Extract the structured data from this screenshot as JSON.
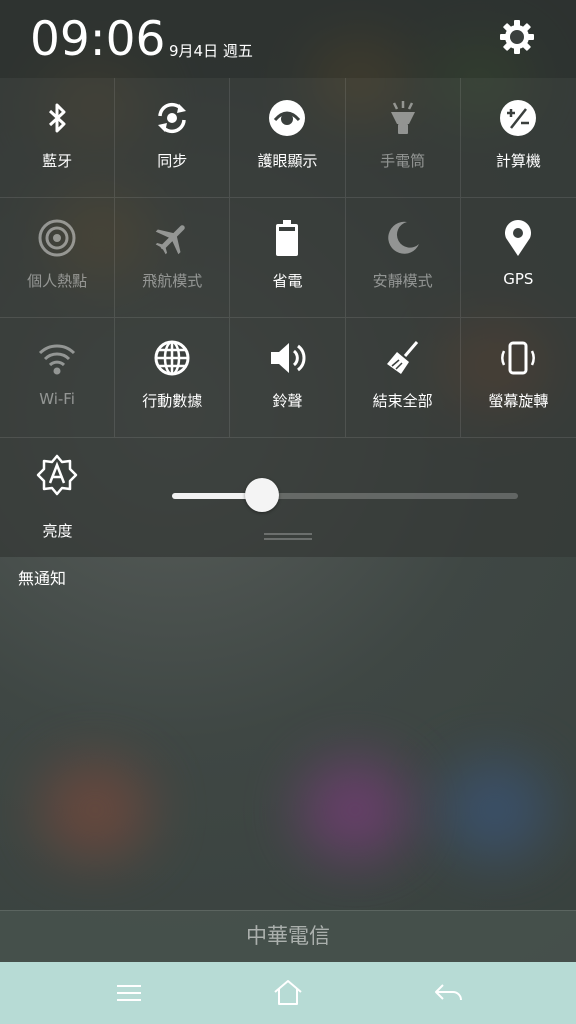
{
  "status": {
    "time": "09:06",
    "date": "9月4日 週五"
  },
  "header": {
    "settings_icon": "gear-icon"
  },
  "tiles": [
    {
      "label": "藍牙",
      "icon": "bluetooth-icon",
      "active": true
    },
    {
      "label": "同步",
      "icon": "sync-icon",
      "active": true
    },
    {
      "label": "護眼顯示",
      "icon": "eye-icon",
      "active": true
    },
    {
      "label": "手電筒",
      "icon": "flashlight-icon",
      "active": false
    },
    {
      "label": "計算機",
      "icon": "calculator-icon",
      "active": true
    },
    {
      "label": "個人熱點",
      "icon": "hotspot-icon",
      "active": false
    },
    {
      "label": "飛航模式",
      "icon": "airplane-icon",
      "active": false
    },
    {
      "label": "省電",
      "icon": "battery-icon",
      "active": true
    },
    {
      "label": "安靜模式",
      "icon": "moon-icon",
      "active": false
    },
    {
      "label": "GPS",
      "icon": "location-pin-icon",
      "active": true
    },
    {
      "label": "Wi-Fi",
      "icon": "wifi-icon",
      "active": false
    },
    {
      "label": "行動數據",
      "icon": "globe-icon",
      "active": true
    },
    {
      "label": "鈴聲",
      "icon": "speaker-icon",
      "active": true
    },
    {
      "label": "結束全部",
      "icon": "broom-icon",
      "active": true
    },
    {
      "label": "螢幕旋轉",
      "icon": "rotate-phone-icon",
      "active": true
    }
  ],
  "brightness": {
    "label": "亮度",
    "icon": "auto-brightness-icon",
    "level": 0.26
  },
  "notifications": {
    "empty_text": "無通知"
  },
  "carrier": {
    "name": "中華電信"
  },
  "navbar": {
    "menu_icon": "menu-icon",
    "home_icon": "home-icon",
    "back_icon": "back-icon"
  }
}
